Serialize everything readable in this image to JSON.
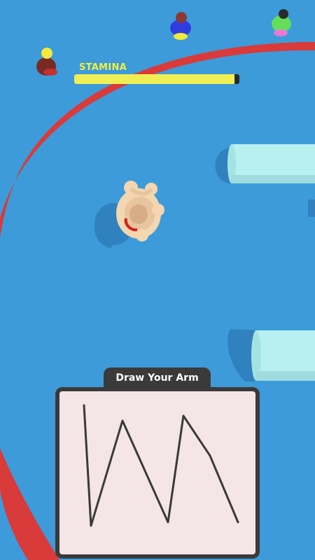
{
  "hud": {
    "stamina_label": "STAMINA",
    "stamina_level": 0.97,
    "colors": {
      "label": "#f2ef3e",
      "fill": "#efee55",
      "track": "#2a2a2a"
    }
  },
  "draw_panel": {
    "tab_label": "Draw Your Arm",
    "colors": {
      "frame": "#3a3a3a",
      "canvas": "#f4e6e6",
      "stroke": "#3a3a3a"
    }
  },
  "scene": {
    "colors": {
      "floor": "#3d9bd9",
      "ring": "#d93a3a",
      "pillar": "#b8f0f0"
    },
    "characters": [
      "player-blob",
      "opponent-yellow",
      "opponent-blue",
      "opponent-green"
    ],
    "icons": [
      "drawn-arm-stroke"
    ]
  }
}
